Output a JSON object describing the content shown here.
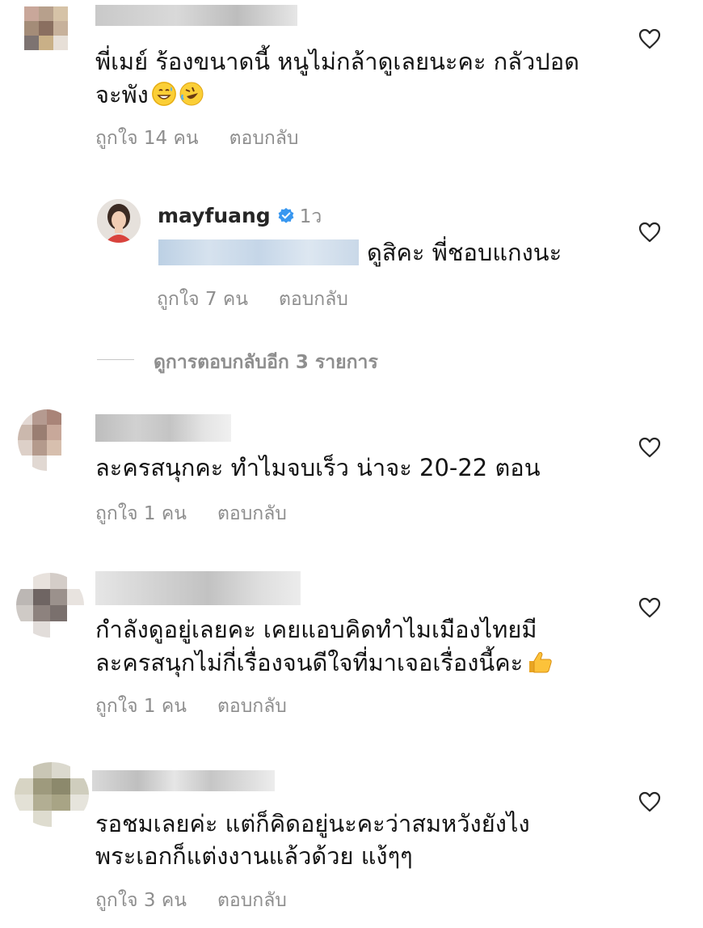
{
  "comments": [
    {
      "text_line1": "พี่เมย์ ร้องขนาดนี้ หนูไม่กล้าดูเลยนะคะ กลัวปอด",
      "text_line2": "จะพัง",
      "likes": "ถูกใจ 14 คน",
      "reply": "ตอบกลับ",
      "emoji": [
        "grinning-sweat",
        "rolling-laughing"
      ]
    },
    {
      "username": "mayfuang",
      "time": "1ว",
      "text": "ดูสิคะ พี่ชอบแกงนะ",
      "likes": "ถูกใจ 7 คน",
      "reply": "ตอบกลับ"
    },
    {
      "text": "ละครสนุกคะ  ทำไมจบเร็ว น่าจะ 20-22 ตอน",
      "likes": "ถูกใจ 1 คน",
      "reply": "ตอบกลับ"
    },
    {
      "text_line1": "กำลังดูอยู่เลยคะ เคยแอบคิดทำไมเมืองไทยมี",
      "text_line2": "ละครสนุกไม่กี่เรื่องจนดีใจที่มาเจอเรื่องนี้คะ",
      "likes": "ถูกใจ 1 คน",
      "reply": "ตอบกลับ",
      "emoji": [
        "thumbs-up"
      ]
    },
    {
      "text_line1": "รอชมเลยค่ะ แต่ก็คิดอยู่นะคะว่าสมหวังยังไง",
      "text_line2": "พระเอกก็แต่งงานแล้วด้วย แง้ๆๆ",
      "likes": "ถูกใจ 3 คน",
      "reply": "ตอบกลับ"
    }
  ],
  "view_more_replies": "ดูการตอบกลับอีก 3 รายการ",
  "colors": {
    "text": "#141414",
    "meta": "#8e8e8e",
    "verified": "#3897f0"
  },
  "icons": [
    "heart-icon",
    "verified-badge-icon"
  ]
}
